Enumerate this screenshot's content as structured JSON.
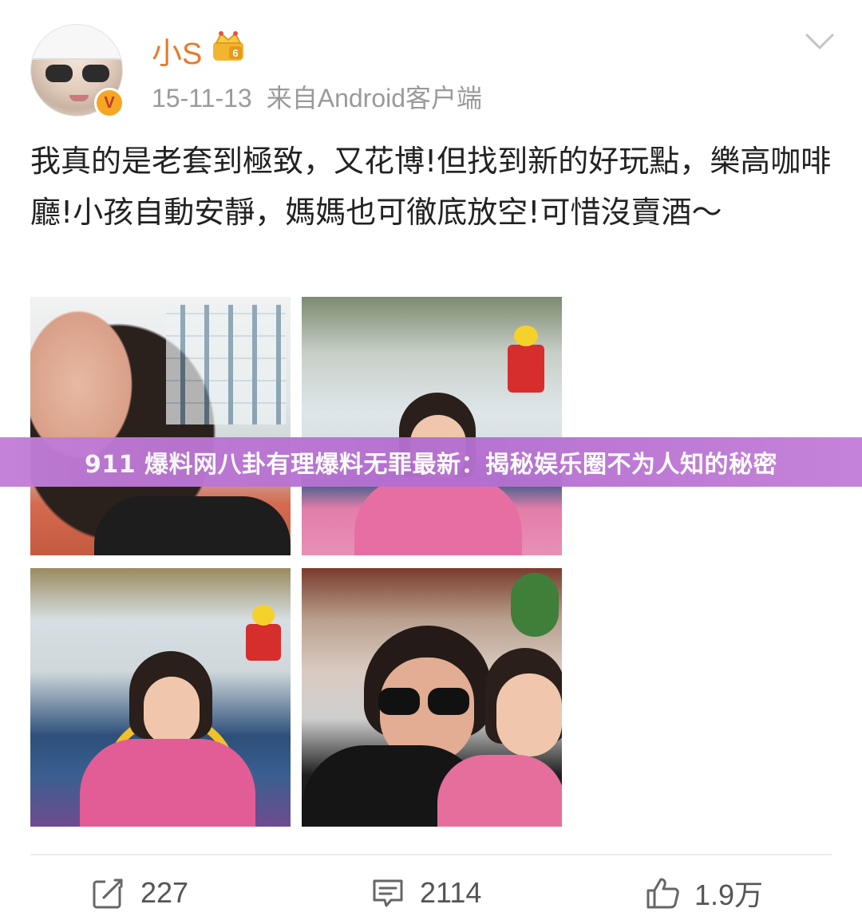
{
  "post": {
    "username": "小S",
    "verified_badge": "V",
    "timestamp": "15-11-13",
    "source": "来自Android客户端",
    "text": "我真的是老套到極致，又花博!但找到新的好玩點，樂高咖啡廳!小孩自動安靜，媽媽也可徹底放空!可惜沒賣酒～",
    "photos": [
      {
        "icon": "photo-selfie-woman"
      },
      {
        "icon": "photo-girl-lego-cafe"
      },
      {
        "icon": "photo-girl-yellow-chair"
      },
      {
        "icon": "photo-mother-daughter"
      }
    ]
  },
  "banner": {
    "title": "911 爆料网八卦有理爆料无罪最新：揭秘娱乐圈不为人知的秘密"
  },
  "actions": {
    "repost_count": "227",
    "comment_count": "2114",
    "like_count": "1.9万"
  },
  "colors": {
    "username": "#e8792a",
    "meta": "#9a9a9a",
    "banner": "#b46ed0",
    "verified": "#f5a623"
  },
  "icons": {
    "crown": "crown-icon",
    "menu": "chevron-down-icon",
    "repost": "repost-icon",
    "comment": "comment-icon",
    "like": "thumbs-up-icon"
  }
}
